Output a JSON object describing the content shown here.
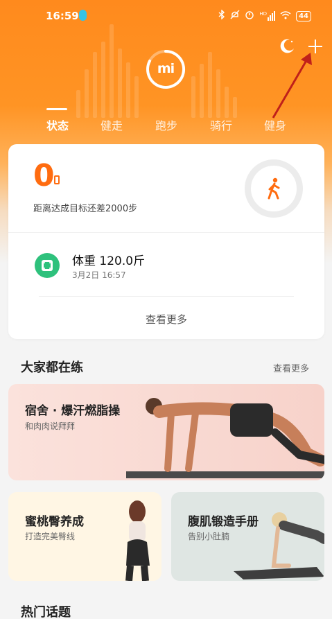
{
  "status_bar": {
    "time": "16:59",
    "icons": [
      "bluetooth-icon",
      "mute-icon",
      "alarm-icon",
      "signal-icon",
      "wifi-icon"
    ],
    "hd_label": "HD",
    "battery": "44"
  },
  "header": {
    "logo": "mi",
    "tabs": [
      {
        "label": "状态",
        "active": true
      },
      {
        "label": "健走",
        "active": false
      },
      {
        "label": "跑步",
        "active": false
      },
      {
        "label": "骑行",
        "active": false
      },
      {
        "label": "健身",
        "active": false
      }
    ]
  },
  "summary_card": {
    "steps": "0",
    "goal_text": "距离达成目标还差2000步",
    "weight_label": "体重 120.0斤",
    "weight_time": "3月2日 16:57",
    "more_label": "查看更多"
  },
  "everyone_section": {
    "title": "大家都在练",
    "more_label": "查看更多"
  },
  "workouts": [
    {
      "title": "宿舍 · 爆汗燃脂操",
      "subtitle": "和肉肉说拜拜"
    },
    {
      "title": "蜜桃臀养成",
      "subtitle": "打造完美臀线"
    },
    {
      "title": "腹肌锻造手册",
      "subtitle": "告别小肚腩"
    }
  ],
  "hot_topics": {
    "title": "热门话题"
  },
  "colors": {
    "accent": "#ff6c10",
    "header_orange": "#ff8a1d",
    "scale_green": "#2ec17c",
    "annotation_arrow": "#c0201a"
  }
}
